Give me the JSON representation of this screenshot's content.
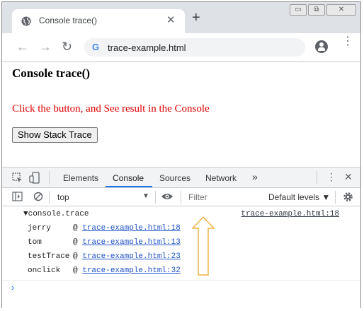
{
  "tab": {
    "title": "Console trace()",
    "close": "✕"
  },
  "new_tab": "+",
  "window_buttons": {
    "minimize": "▭",
    "restore": "⧉",
    "close": "✕"
  },
  "toolbar": {
    "back": "←",
    "forward": "→",
    "reload": "↻",
    "google": "G",
    "url": "trace-example.html",
    "menu": "⋮"
  },
  "page": {
    "heading": "Console trace()",
    "paragraph": "Click the button, and See result in the Console",
    "button": "Show Stack Trace"
  },
  "devtools": {
    "tabs": [
      "Elements",
      "Console",
      "Sources",
      "Network"
    ],
    "more_tabs": "»",
    "menu": "⋮",
    "close": "✕",
    "context": "top",
    "filter_placeholder": "Filter",
    "levels": "Default levels ▼"
  },
  "console": {
    "trace_label": "▼console.trace",
    "trace_source": "trace-example.html:18",
    "frames": [
      {
        "fn": "jerry",
        "at": "@",
        "link": "trace-example.html:18"
      },
      {
        "fn": "tom",
        "at": "@",
        "link": "trace-example.html:13"
      },
      {
        "fn": "testTrace",
        "at": "@",
        "link": "trace-example.html:23"
      },
      {
        "fn": "onclick",
        "at": "@",
        "link": "trace-example.html:32"
      }
    ],
    "prompt": "›"
  },
  "colors": {
    "accent": "#1a73e8",
    "paragraph": "#e00000",
    "arrow": "#f0b040"
  }
}
